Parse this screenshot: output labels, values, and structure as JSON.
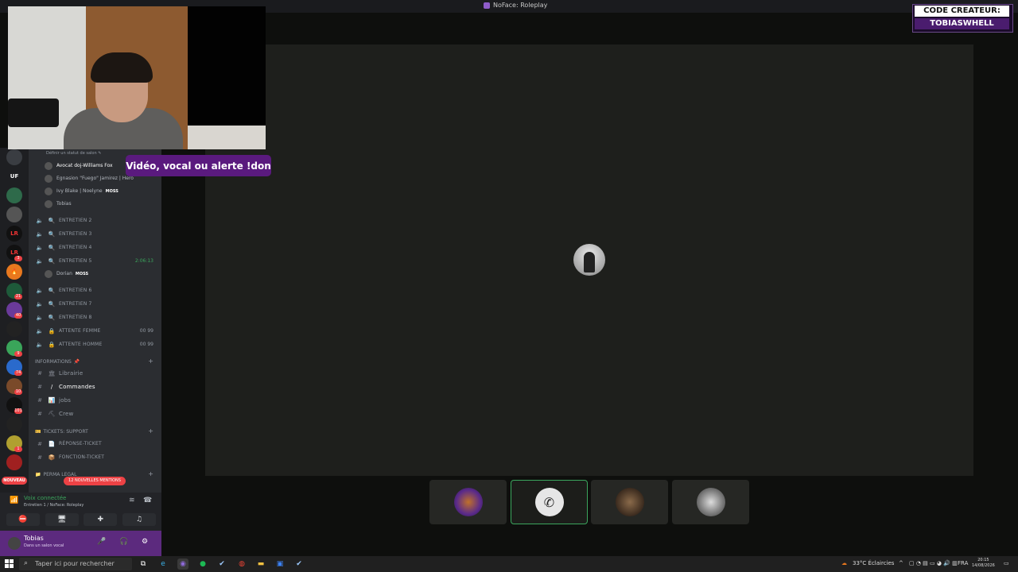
{
  "window": {
    "title": "NoFace: Roleplay"
  },
  "creator_badge": {
    "line1": "CODE CREATEUR:",
    "line2": "TOBIASWHELL"
  },
  "overlay": {
    "cta": "Vidéo, vocal ou alerte !don"
  },
  "server_rail": {
    "label_uf": "UF",
    "badges": [
      "3",
      "21",
      "1",
      "40",
      "9",
      "74",
      "10",
      "101",
      "1"
    ],
    "nouveau": "NOUVEAU"
  },
  "sidebar": {
    "status_hint": "Définir un statut de salon ✎",
    "voice_users": [
      {
        "name": "Avocat doj-Williams Fox",
        "tag": ""
      },
      {
        "name": "Egnasion \"Fuego\" Jamirez | Hero",
        "tag": ""
      },
      {
        "name": "Ivy Blake | Noelyne",
        "tag": "MOSS"
      },
      {
        "name": "Tobias",
        "tag": ""
      }
    ],
    "entretien_channels": [
      {
        "label": "ENTRETIEN 2"
      },
      {
        "label": "ENTRETIEN 3"
      },
      {
        "label": "ENTRETIEN 4"
      },
      {
        "label": "ENTRETIEN 5",
        "timer": "2:06:13"
      }
    ],
    "entretien5_user": {
      "name": "Dorian",
      "tag": "MOSS"
    },
    "entretien_channels_2": [
      {
        "label": "ENTRETIEN 6"
      },
      {
        "label": "ENTRETIEN 7"
      },
      {
        "label": "ENTRETIEN 8"
      }
    ],
    "attente": [
      {
        "label": "ATTENTE FEMME",
        "count1": "00",
        "count2": "99"
      },
      {
        "label": "ATTENTE HOMME",
        "count1": "00",
        "count2": "99"
      }
    ],
    "cat_informations": "INFORMATIONS",
    "info_channels": [
      {
        "label": "Librairie",
        "icon": "🏛"
      },
      {
        "label": "Commandes",
        "icon": "/",
        "active": true
      },
      {
        "label": "jobs",
        "icon": "📊"
      },
      {
        "label": "Crew",
        "icon": "⛏"
      }
    ],
    "cat_tickets": "TICKETS: SUPPORT",
    "ticket_channels": [
      {
        "label": "RÉPONSE-TICKET",
        "icon": "📄"
      },
      {
        "label": "FONCTION-TICKET",
        "icon": "📦"
      }
    ],
    "cat_perma": "PERMA LEGAL",
    "mentions": "12 NOUVELLES MENTIONS"
  },
  "voice_panel": {
    "status": "Voix connectée",
    "channel": "Entretien 1 / NoFace: Roleplay"
  },
  "user_panel": {
    "name": "Tobias",
    "sub": "Dans un salon vocal"
  },
  "taskbar": {
    "search_placeholder": "Taper ici pour rechercher",
    "weather": "33°C  Éclaircies",
    "lang": "FRA",
    "time": "20:15",
    "date": "14/08/2026"
  },
  "colors": {
    "accent": "#5c2a7e",
    "green": "#3ba55d",
    "red": "#ed4245"
  }
}
